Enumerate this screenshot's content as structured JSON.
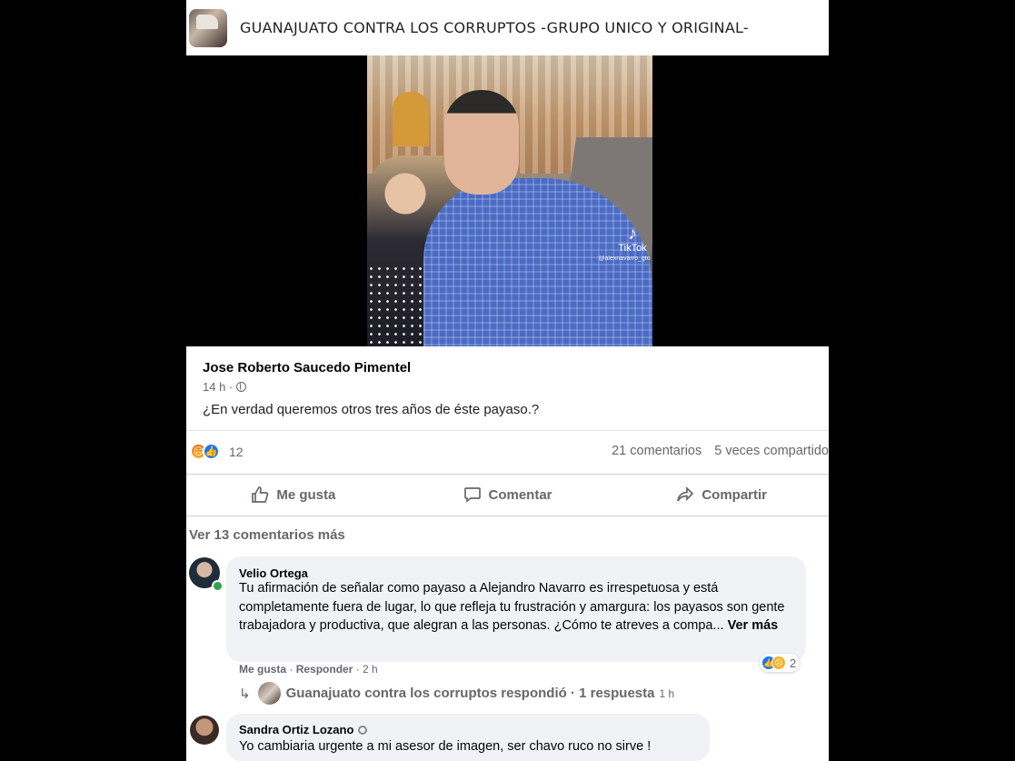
{
  "group": {
    "name": "GUANAJUATO CONTRA LOS CORRUPTOS -GRUPO UNICO Y ORIGINAL-"
  },
  "video": {
    "watermark": "TikTok",
    "handle": "@alexnavarro_gto"
  },
  "post": {
    "author": "Jose Roberto Saucedo Pimentel",
    "time": "14 h ·",
    "text": "¿En verdad queremos otros tres años de éste payaso.?",
    "reaction_count": "12",
    "comments_count": "21 comentarios",
    "shares_count": "5 veces compartido"
  },
  "actions": {
    "like": "Me gusta",
    "comment": "Comentar",
    "share": "Compartir"
  },
  "more_comments": "Ver 13 comentarios más",
  "comments": [
    {
      "name": "Velio Ortega",
      "text": "Tu afirmación de señalar como payaso a Alejandro Navarro es irrespetuosa y está completamente fuera de lugar, lo que refleja tu frustración y amargura: los payasos son gente trabajadora y productiva, que alegran a las personas. ¿Cómo te atreves a compa...",
      "see_more": "Ver más",
      "reaction_count": "2",
      "like_label": "Me gusta",
      "reply_label": "Responder",
      "time": "2 h",
      "reply_summary": "Guanajuato contra los corruptos respondió · 1 respuesta",
      "reply_time": "1 h"
    },
    {
      "name": "Sandra Ortiz Lozano",
      "text": "Yo cambiaria urgente a mi asesor de imagen, ser chavo ruco no sirve !"
    }
  ],
  "colors": {
    "like_blue": "#1877f2",
    "angry_orange": "#e9710f",
    "online_green": "#31a24c",
    "secondary_text": "#65676b",
    "bubble_bg": "#f0f2f5"
  },
  "icons": [
    "thumbs-up-icon",
    "comment-icon",
    "share-icon",
    "globe-icon",
    "angry-reaction-icon",
    "like-reaction-icon",
    "sad-reaction-icon",
    "reply-arrow-icon",
    "top-fan-badge-icon"
  ]
}
